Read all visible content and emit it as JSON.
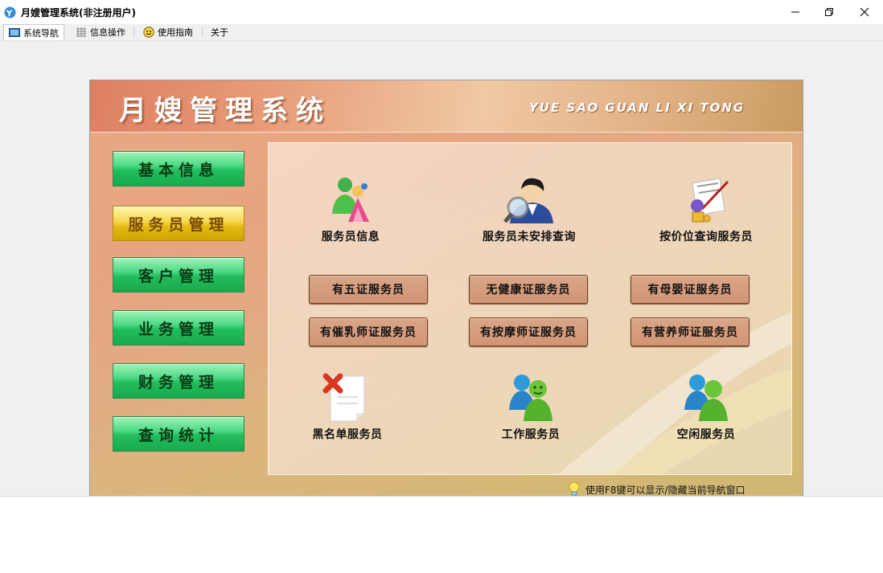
{
  "window": {
    "title": "月嫂管理系统(非注册用户)"
  },
  "menu": {
    "items": [
      {
        "label": "系统导航",
        "icon": "monitor-icon"
      },
      {
        "label": "信息操作",
        "icon": "grid-icon"
      },
      {
        "label": "使用指南",
        "icon": "smiley-icon"
      },
      {
        "label": "关于"
      }
    ]
  },
  "header": {
    "title": "月嫂管理系统",
    "subtitle": "YUE SAO GUAN LI XI TONG"
  },
  "nav": {
    "items": [
      {
        "label": "基本信息"
      },
      {
        "label": "服务员管理",
        "active": true
      },
      {
        "label": "客户管理"
      },
      {
        "label": "业务管理"
      },
      {
        "label": "财务管理"
      },
      {
        "label": "查询统计"
      }
    ]
  },
  "features": {
    "top": [
      {
        "label": "服务员信息",
        "icon": "waiters-group-icon"
      },
      {
        "label": "服务员未安排查询",
        "icon": "magnifier-person-icon"
      },
      {
        "label": "按价位查询服务员",
        "icon": "price-document-icon"
      }
    ],
    "bottom": [
      {
        "label": "黑名单服务员",
        "icon": "blacklist-document-icon"
      },
      {
        "label": "工作服务员",
        "icon": "working-people-icon"
      },
      {
        "label": "空闲服务员",
        "icon": "idle-people-icon"
      }
    ]
  },
  "cert_buttons": [
    "有五证服务员",
    "无健康证服务员",
    "有母婴证服务员",
    "有催乳师证服务员",
    "有按摩师证服务员",
    "有营养师证服务员"
  ],
  "hint": {
    "text": "使用F8键可以显示/隐藏当前导航窗口",
    "icon": "lightbulb-icon"
  },
  "colors": {
    "nav_green": "#21bd5c",
    "nav_active_yellow": "#e4bb13",
    "cert_button": "#cf9574"
  }
}
